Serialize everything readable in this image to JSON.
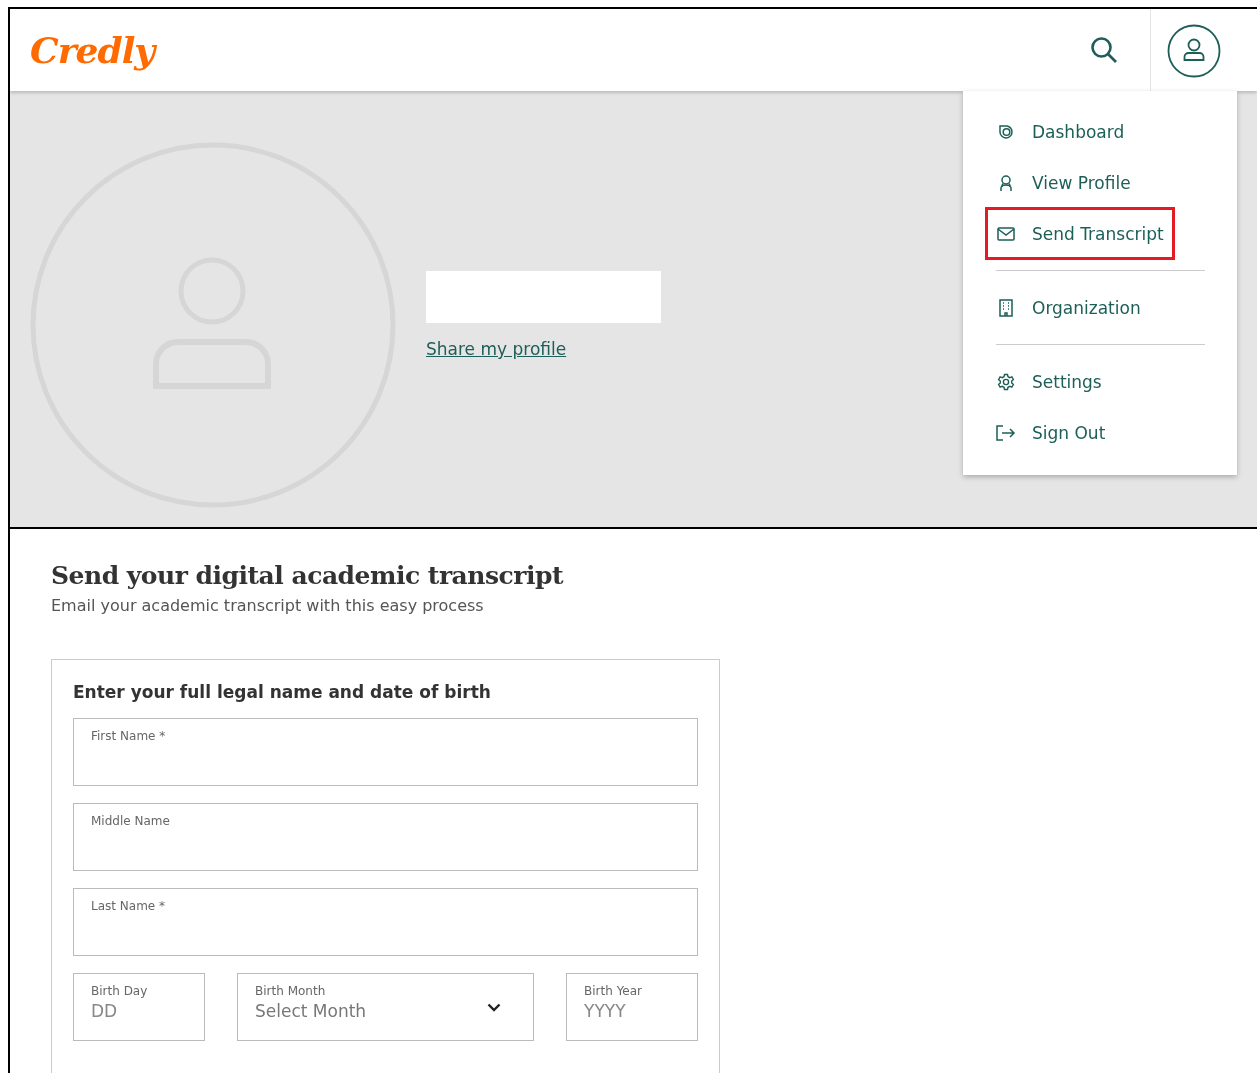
{
  "header": {
    "logo": "Credly"
  },
  "profile": {
    "share_link": "Share my profile"
  },
  "user_menu": {
    "items": [
      {
        "label": "Dashboard",
        "kind": "dashboard",
        "highlighted": false,
        "divider_after": false
      },
      {
        "label": "View Profile",
        "kind": "profile",
        "highlighted": false,
        "divider_after": false
      },
      {
        "label": "Send Transcript",
        "kind": "mail",
        "highlighted": true,
        "divider_after": true
      },
      {
        "label": "Organization",
        "kind": "building",
        "highlighted": false,
        "divider_after": true
      },
      {
        "label": "Settings",
        "kind": "gear",
        "highlighted": false,
        "divider_after": false
      },
      {
        "label": "Sign Out",
        "kind": "signout",
        "highlighted": false,
        "divider_after": false
      }
    ]
  },
  "page": {
    "title": "Send your digital academic transcript",
    "subtitle": "Email your academic transcript with this easy process"
  },
  "form": {
    "heading": "Enter your full legal name and date of birth",
    "fields": [
      {
        "label": "First Name *"
      },
      {
        "label": "Middle Name"
      },
      {
        "label": "Last Name *"
      }
    ],
    "birth_fields": [
      {
        "kind": "text",
        "label": "Birth Day",
        "placeholder": "DD"
      },
      {
        "kind": "select",
        "label": "Birth Month",
        "value": "Select Month"
      },
      {
        "kind": "text",
        "label": "Birth Year",
        "placeholder": "YYYY"
      }
    ]
  }
}
